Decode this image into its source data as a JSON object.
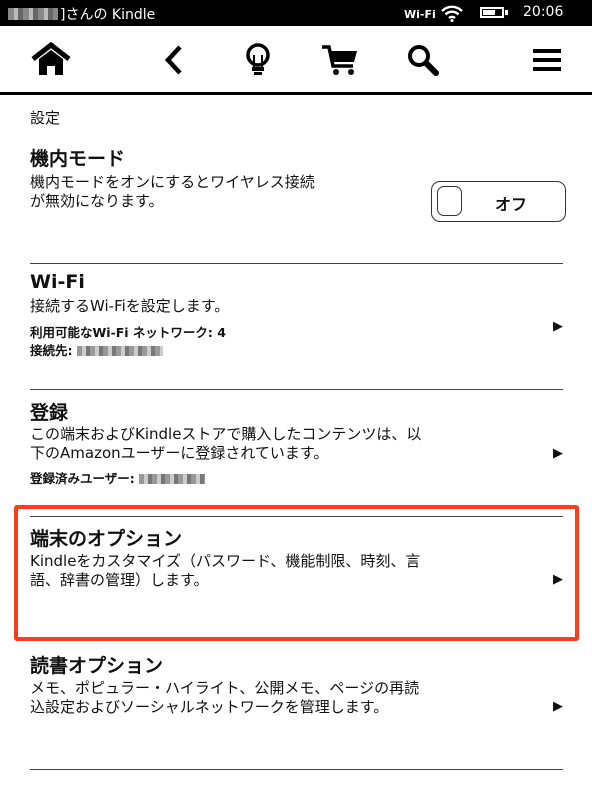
{
  "status_bar": {
    "title": "]さんの Kindle",
    "wifi_label": "Wi-Fi",
    "battery_level": 0.65,
    "time": "20:06"
  },
  "toolbar": {
    "icons": [
      "home-icon",
      "back-icon",
      "lightbulb-icon",
      "cart-icon",
      "search-icon",
      "menu-icon"
    ]
  },
  "page": {
    "section_label": "設定"
  },
  "settings": [
    {
      "title": "機内モード",
      "desc_lines": [
        "機内モードをオンにするとワイヤレス接続",
        "が無効になります。"
      ],
      "toggle_label": "オフ"
    },
    {
      "title": "Wi-Fi",
      "desc_lines": [
        "接続するWi-Fiを設定します。"
      ],
      "meta_lines": [
        "利用可能なWi-Fi ネットワーク: 4",
        "接続先:"
      ],
      "arrow": "▶"
    },
    {
      "title": "登録",
      "desc_lines": [
        "この端末およびKindleストアで購入したコンテンツは、以",
        "下のAmazonユーザーに登録されています。"
      ],
      "meta_lines": [
        "登録済みユーザー:"
      ],
      "arrow": "▶"
    },
    {
      "title": "端末のオプション",
      "desc_lines": [
        "Kindleをカスタマイズ（パスワード、機能制限、時刻、言",
        "語、辞書の管理）します。"
      ],
      "arrow": "▶"
    },
    {
      "title": "読書オプション",
      "desc_lines": [
        "メモ、ポピュラー・ハイライト、公開メモ、ページの再読",
        "込設定およびソーシャルネットワークを管理します。"
      ],
      "arrow": "▶"
    }
  ],
  "colors": {
    "highlight": "#ff3b1e",
    "status_bar": "#000000"
  }
}
